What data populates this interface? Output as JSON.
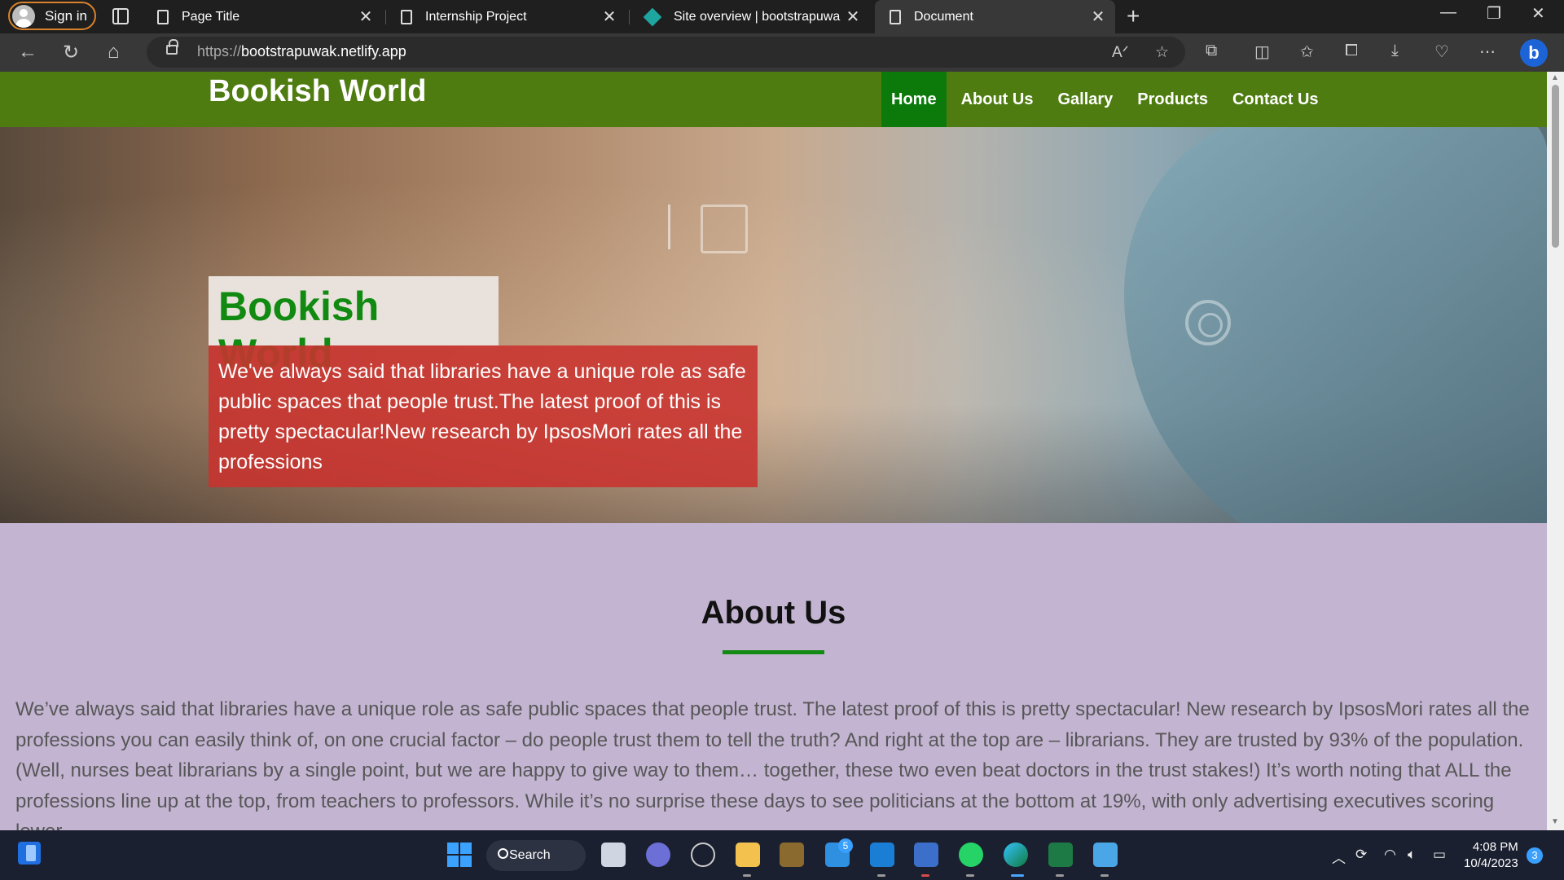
{
  "browser": {
    "signin_label": "Sign in",
    "tabs": [
      {
        "title": "Page Title",
        "icon": "page-icon"
      },
      {
        "title": "Internship Project",
        "icon": "page-icon"
      },
      {
        "title": "Site overview | bootstrapuwak | N",
        "icon": "netlify-icon"
      },
      {
        "title": "Document",
        "icon": "page-icon",
        "active": true
      }
    ],
    "close_glyph": "✕",
    "new_tab_glyph": "+",
    "url_prefix": "https://",
    "url_host": "bootstrapuwak.netlify.app"
  },
  "site": {
    "brand": "Bookish World",
    "nav": [
      "Home",
      "About Us",
      "Gallary",
      "Products",
      "Contact Us"
    ],
    "active_nav": "Home",
    "hero": {
      "title": "Bookish World",
      "text": "We've always said that libraries have a unique role as safe public spaces that people trust.The latest proof of this is pretty spectacular!New research by IpsosMori rates all the professions"
    },
    "about": {
      "heading": "About Us",
      "body": "We’ve always said that libraries have a unique role as safe public spaces that people trust. The latest proof of this is pretty spectacular! New research by IpsosMori rates all the professions you can easily think of, on one crucial factor – do people trust them to tell the truth? And right at the top are – librarians. They are trusted by 93% of the population. (Well, nurses beat librarians by a single point, but we are happy to give way to them… together, these two even beat doctors in the trust stakes!) It’s worth noting that ALL the professions line up at the top, from teachers to professors. While it’s no surprise these days to see politicians at the bottom at 19%, with only advertising executives scoring lower."
    },
    "colors": {
      "nav_bg": "#4f7c11",
      "nav_active": "#0b7a0b",
      "hero_title": "#118a11",
      "hero_text_bg": "#c8322d",
      "about_bg": "#c3b4d2"
    }
  },
  "taskbar": {
    "search_label": "Search",
    "mail_badge": "5",
    "time": "4:08 PM",
    "date": "10/4/2023",
    "notification_count": "3"
  }
}
